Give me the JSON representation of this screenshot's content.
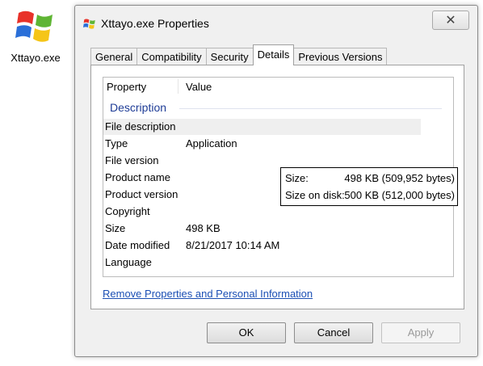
{
  "desktop": {
    "icon_label": "Xttayo.exe",
    "icon": "windows-logo-icon"
  },
  "window": {
    "title": "Xttayo.exe Properties",
    "title_icon": "windows-logo-icon",
    "close_icon": "close-icon",
    "close_glyph": "✕"
  },
  "tabs": [
    {
      "label": "General",
      "active": false
    },
    {
      "label": "Compatibility",
      "active": false
    },
    {
      "label": "Security",
      "active": false
    },
    {
      "label": "Details",
      "active": true
    },
    {
      "label": "Previous Versions",
      "active": false
    }
  ],
  "details": {
    "columns": {
      "property": "Property",
      "value": "Value"
    },
    "section": "Description",
    "rows": [
      {
        "property": "File description",
        "value": ""
      },
      {
        "property": "Type",
        "value": "Application"
      },
      {
        "property": "File version",
        "value": ""
      },
      {
        "property": "Product name",
        "value": ""
      },
      {
        "property": "Product version",
        "value": ""
      },
      {
        "property": "Copyright",
        "value": ""
      },
      {
        "property": "Size",
        "value": "498 KB"
      },
      {
        "property": "Date modified",
        "value": "8/21/2017 10:14 AM"
      },
      {
        "property": "Language",
        "value": ""
      }
    ]
  },
  "tooltip": {
    "size_label": "Size:",
    "size_value": "498 KB (509,952 bytes)",
    "disk_label": "Size on disk:",
    "disk_value": "500 KB (512,000 bytes)"
  },
  "link": "Remove Properties and Personal Information",
  "buttons": {
    "ok": "OK",
    "cancel": "Cancel",
    "apply": "Apply"
  },
  "colors": {
    "section_title": "#1e3c96",
    "link": "#1b4fb4",
    "logo_red": "#e8322a",
    "logo_green": "#5fb534",
    "logo_blue": "#2a6fd8",
    "logo_yellow": "#f5c518"
  }
}
